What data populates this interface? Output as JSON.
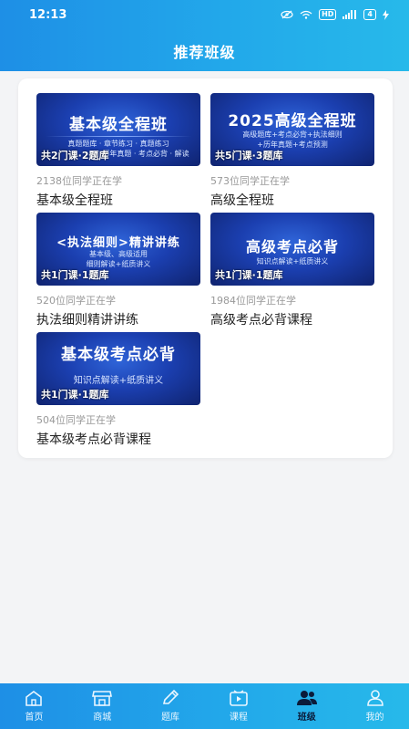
{
  "status_bar": {
    "time": "12:13",
    "hd": "HD",
    "battery": "4"
  },
  "header": {
    "title": "推荐班级"
  },
  "courses": [
    {
      "cover_title": "基本级全程班",
      "cover_sub1": "真题题库 · 章节练习 · 真题练习",
      "cover_sub2": "历年真题 · 考点必背 · 解读",
      "count": "共2门课·2题库",
      "learners": "2138位同学正在学",
      "name": "基本级全程班"
    },
    {
      "cover_title": "2025高级全程班",
      "cover_sub1": "高级题库+考点必背+执法细则",
      "cover_sub2": "+历年真题+考点预测",
      "count": "共5门课·3题库",
      "learners": "573位同学正在学",
      "name": "高级全程班"
    },
    {
      "cover_title": "<执法细则>精讲讲练",
      "cover_sub1": "基本级、高级适用",
      "cover_sub2": "细则解读+纸质讲义",
      "count": "共1门课·1题库",
      "learners": "520位同学正在学",
      "name": "执法细则精讲讲练"
    },
    {
      "cover_title": "高级考点必背",
      "cover_sub1": "知识点解读+纸质讲义",
      "cover_sub2": "",
      "count": "共1门课·1题库",
      "learners": "1984位同学正在学",
      "name": "高级考点必背课程"
    },
    {
      "cover_title": "基本级考点必背",
      "cover_sub1": "知识点解读+纸质讲义",
      "cover_sub2": "",
      "count": "共1门课·1题库",
      "learners": "504位同学正在学",
      "name": "基本级考点必背课程"
    }
  ],
  "tabs": [
    {
      "label": "首页",
      "icon": "home-icon"
    },
    {
      "label": "商城",
      "icon": "store-icon"
    },
    {
      "label": "题库",
      "icon": "pencil-icon"
    },
    {
      "label": "课程",
      "icon": "video-icon"
    },
    {
      "label": "班级",
      "icon": "group-icon"
    },
    {
      "label": "我的",
      "icon": "user-icon"
    }
  ],
  "colors": {
    "accent": "#1e8fe6",
    "active_tab": "#0b1b3a"
  }
}
